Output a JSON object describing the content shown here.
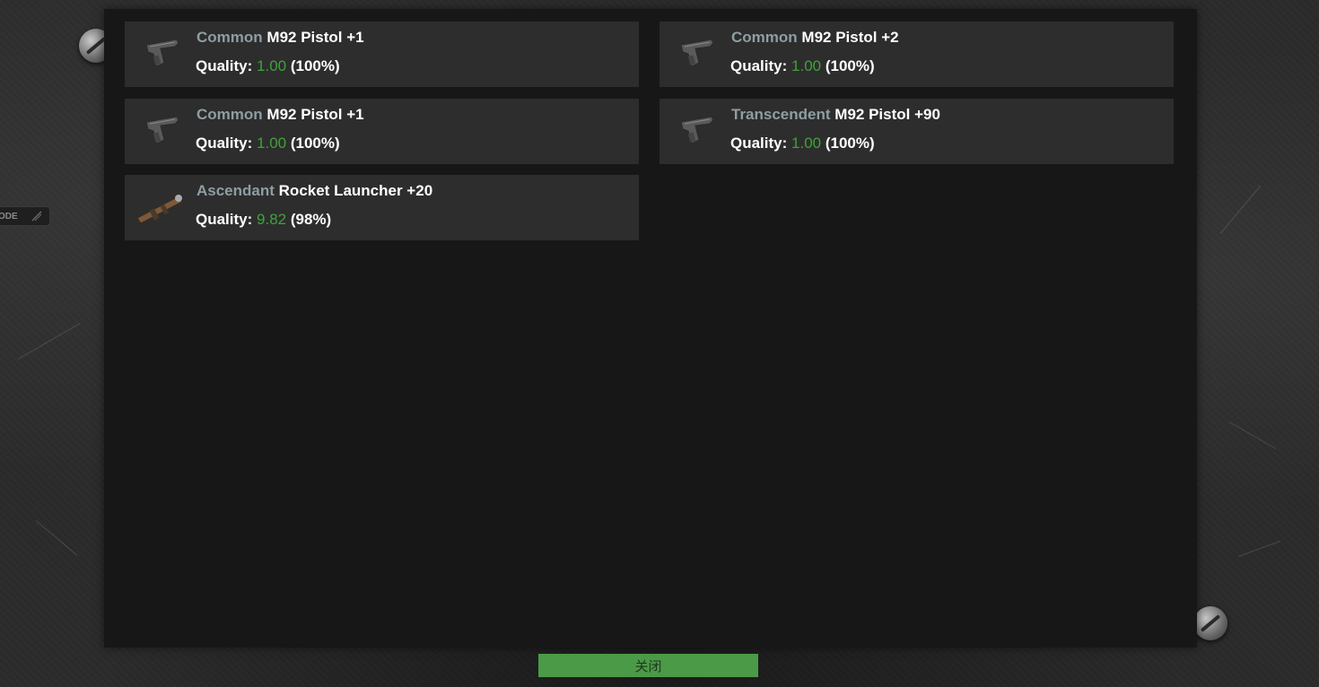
{
  "side_tag": {
    "label": "ODE"
  },
  "items": [
    {
      "rarity": "Common",
      "name": "M92 Pistol +1",
      "quality_label": "Quality:",
      "quality_value": "1.00",
      "quality_pct": "(100%)",
      "icon": "pistol-icon",
      "rarity_color": "#8e9ea3"
    },
    {
      "rarity": "Common",
      "name": "M92 Pistol +2",
      "quality_label": "Quality:",
      "quality_value": "1.00",
      "quality_pct": "(100%)",
      "icon": "pistol-icon",
      "rarity_color": "#8e9ea3"
    },
    {
      "rarity": "Common",
      "name": "M92 Pistol +1",
      "quality_label": "Quality:",
      "quality_value": "1.00",
      "quality_pct": "(100%)",
      "icon": "pistol-icon",
      "rarity_color": "#8e9ea3"
    },
    {
      "rarity": "Transcendent",
      "name": "M92 Pistol +90",
      "quality_label": "Quality:",
      "quality_value": "1.00",
      "quality_pct": "(100%)",
      "icon": "pistol-icon",
      "rarity_color": "#8e9ea3"
    },
    {
      "rarity": "Ascendant",
      "name": "Rocket Launcher +20",
      "quality_label": "Quality:",
      "quality_value": "9.82",
      "quality_pct": "(98%)",
      "icon": "rocket-launcher-icon",
      "rarity_color": "#8e9ea3"
    }
  ],
  "close_button": {
    "label": "关闭"
  },
  "colors": {
    "quality_value": "#3fa33a",
    "button_bg": "#4b9a48",
    "panel_bg": "#171717",
    "card_bg": "#2d2d2d"
  }
}
